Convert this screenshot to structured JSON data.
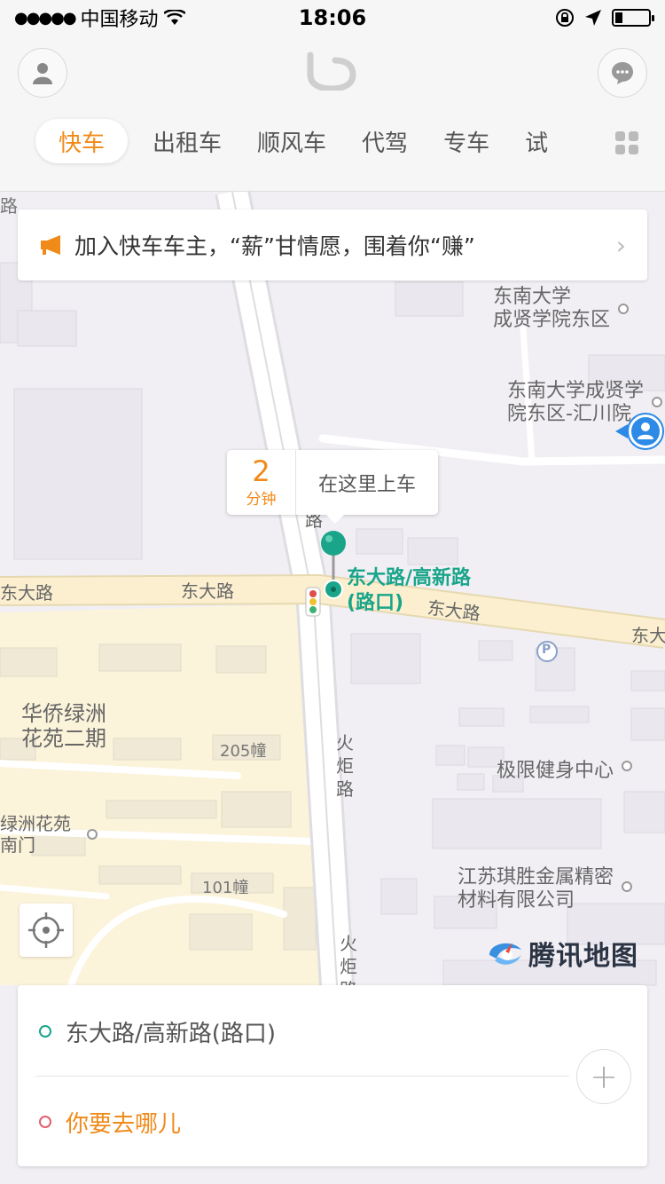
{
  "status_bar": {
    "signal_dots": "●●●●●",
    "carrier": "中国移动",
    "time": "18:06"
  },
  "header": {
    "tabs": [
      {
        "label": "快车",
        "active": true
      },
      {
        "label": "出租车",
        "active": false
      },
      {
        "label": "顺风车",
        "active": false
      },
      {
        "label": "代驾",
        "active": false
      },
      {
        "label": "专车",
        "active": false
      },
      {
        "label": "试",
        "active": false
      }
    ]
  },
  "banner": {
    "text": "加入快车车主，“薪”甘情愿，围着你“赚”",
    "chevron": "›"
  },
  "map": {
    "labels": {
      "school_east_district": "东南大学\n成贤学院东区",
      "huichuan_court": "东南大学成贤学\n院东区-汇川院",
      "road_dongda_left": "东大路",
      "road_dongda_mid": "东大路",
      "road_dongda_right": "东大路",
      "road_dongda_far_right": "东大",
      "road_dongda_top_fragment": "路",
      "road_dongda_edge_left": "东大路",
      "road_huoju_1": "火炬路",
      "road_huoju_2": "火炬路",
      "huaqiao": "华侨绿洲\n花苑二期",
      "building_205": "205幢",
      "building_101": "101幢",
      "lvzhou_south_gate": "绿洲花苑\n南门",
      "fitness_center": "极限健身中心",
      "metal_company": "江苏琪胜金属精密\n材料有限公司",
      "parking": "P",
      "top_left_fragment": "路"
    },
    "pickup": {
      "eta_value": "2",
      "eta_unit": "分钟",
      "action": "在这里上车",
      "location_label": "东大路/高新路\n(路口)"
    },
    "logo_text": "腾讯地图"
  },
  "route": {
    "from": "东大路/高新路(路口)",
    "to": "你要去哪儿",
    "add_stop": "+"
  },
  "colors": {
    "accent_orange": "#f08a19",
    "pin_green": "#1aa58a",
    "map_background": "#f1eff4",
    "road_yellow": "#fbf2d4"
  }
}
